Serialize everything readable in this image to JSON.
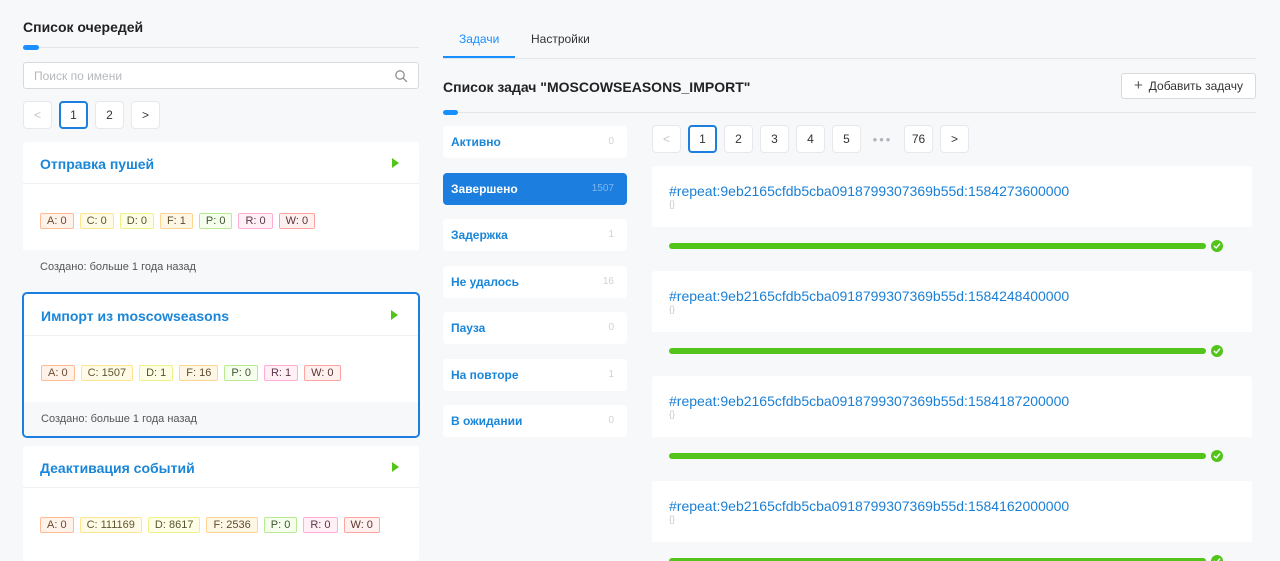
{
  "queues": {
    "title": "Список очередей",
    "search_placeholder": "Поиск по имени",
    "pager": {
      "prev": "<",
      "pages": [
        "1",
        "2"
      ],
      "next": ">"
    },
    "items": [
      {
        "name": "Отправка пушей",
        "tags": [
          {
            "k": "a",
            "text": "A: 0"
          },
          {
            "k": "c",
            "text": "C: 0"
          },
          {
            "k": "d",
            "text": "D: 0"
          },
          {
            "k": "f",
            "text": "F: 1"
          },
          {
            "k": "p",
            "text": "P: 0"
          },
          {
            "k": "r",
            "text": "R: 0"
          },
          {
            "k": "w",
            "text": "W: 0"
          }
        ],
        "created": "Создано: больше 1 года назад"
      },
      {
        "name": "Импорт из moscowseasons",
        "tags": [
          {
            "k": "a",
            "text": "A: 0"
          },
          {
            "k": "c",
            "text": "C: 1507"
          },
          {
            "k": "d",
            "text": "D: 1"
          },
          {
            "k": "f",
            "text": "F: 16"
          },
          {
            "k": "p",
            "text": "P: 0"
          },
          {
            "k": "r",
            "text": "R: 1"
          },
          {
            "k": "w",
            "text": "W: 0"
          }
        ],
        "created": "Создано: больше 1 года назад"
      },
      {
        "name": "Деактивация событий",
        "tags": [
          {
            "k": "a",
            "text": "A: 0"
          },
          {
            "k": "c",
            "text": "C: 111169"
          },
          {
            "k": "d",
            "text": "D: 8617"
          },
          {
            "k": "f",
            "text": "F: 2536"
          },
          {
            "k": "p",
            "text": "P: 0"
          },
          {
            "k": "r",
            "text": "R: 0"
          },
          {
            "k": "w",
            "text": "W: 0"
          }
        ],
        "created": ""
      }
    ]
  },
  "tabs": {
    "tasks": "Задачи",
    "settings": "Настройки"
  },
  "tasks": {
    "title": "Список задач \"MOSCOWSEASONS_IMPORT\"",
    "add_button": "Добавить задачу",
    "statuses": [
      {
        "label": "Активно",
        "count": "0"
      },
      {
        "label": "Завершено",
        "count": "1507"
      },
      {
        "label": "Задержка",
        "count": "1"
      },
      {
        "label": "Не удалось",
        "count": "16"
      },
      {
        "label": "Пауза",
        "count": "0"
      },
      {
        "label": "На повторе",
        "count": "1"
      },
      {
        "label": "В ожидании",
        "count": "0"
      }
    ],
    "pager": {
      "prev": "<",
      "pages": [
        "1",
        "2",
        "3",
        "4",
        "5"
      ],
      "ellipsis": "•••",
      "last": "76",
      "next": ">"
    },
    "jobs": [
      {
        "id": "#repeat:9eb2165cfdb5cba0918799307369b55d:1584273600000",
        "data": "{}",
        "progress": 100
      },
      {
        "id": "#repeat:9eb2165cfdb5cba0918799307369b55d:1584248400000",
        "data": "{}",
        "progress": 100
      },
      {
        "id": "#repeat:9eb2165cfdb5cba0918799307369b55d:1584187200000",
        "data": "{}",
        "progress": 100
      },
      {
        "id": "#repeat:9eb2165cfdb5cba0918799307369b55d:1584162000000",
        "data": "{}",
        "progress": 100
      }
    ]
  },
  "colors": {
    "accent": "#1890ff",
    "link": "#1a86d8",
    "success": "#52c41a"
  }
}
